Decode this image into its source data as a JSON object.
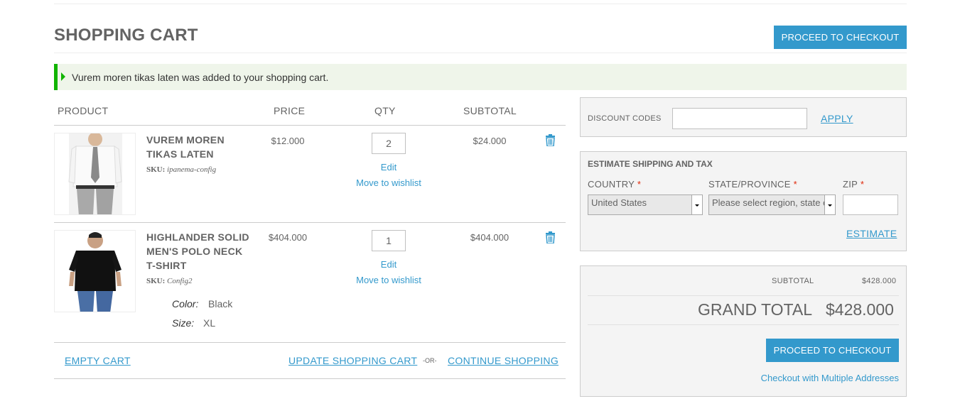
{
  "page": {
    "title": "SHOPPING CART",
    "top_checkout_label": "PROCEED TO CHECKOUT"
  },
  "message": "Vurem moren tikas laten was added to your shopping cart.",
  "table": {
    "headers": {
      "product": "PRODUCT",
      "price": "PRICE",
      "qty": "QTY",
      "subtotal": "SUBTOTAL"
    },
    "edit_label": "Edit",
    "wishlist_label": "Move to wishlist",
    "sku_label": "SKU:",
    "items": [
      {
        "name_line1": "VUREM MOREN",
        "name_line2": "TIKAS LATEN",
        "name_line3": "",
        "sku": "ipanema-config",
        "price": "$12.000",
        "qty": "2",
        "subtotal": "$24.000",
        "options": []
      },
      {
        "name_line1": "HIGHLANDER SOLID",
        "name_line2": "MEN'S POLO NECK",
        "name_line3": "T-SHIRT",
        "sku": "Config2",
        "price": "$404.000",
        "qty": "1",
        "subtotal": "$404.000",
        "options": [
          {
            "label": "Color:",
            "value": "Black"
          },
          {
            "label": "Size:",
            "value": "XL"
          }
        ]
      }
    ]
  },
  "actions": {
    "empty_cart": "EMPTY CART",
    "update_cart": "UPDATE SHOPPING CART",
    "or": "-OR-",
    "continue_shopping": "CONTINUE SHOPPING"
  },
  "discount": {
    "label": "DISCOUNT CODES",
    "value": "",
    "apply_label": "APPLY"
  },
  "shipping": {
    "title": "ESTIMATE SHIPPING AND TAX",
    "country_label": "COUNTRY",
    "country_value": "United States",
    "state_label": "STATE/PROVINCE",
    "state_value": "Please select region, state or province",
    "zip_label": "ZIP",
    "zip_value": "",
    "required_mark": "*",
    "estimate_label": "ESTIMATE"
  },
  "totals": {
    "subtotal_label": "SUBTOTAL",
    "subtotal_value": "$428.000",
    "grand_total_label": "GRAND TOTAL",
    "grand_total_value": "$428.000",
    "checkout_label": "PROCEED TO CHECKOUT",
    "multi_address_label": "Checkout with Multiple Addresses"
  },
  "colors": {
    "accent": "#3399cc",
    "success": "#11b400",
    "required": "#df280a"
  },
  "icons": {
    "trash": "trash-icon",
    "message": "success-arrow-icon"
  }
}
